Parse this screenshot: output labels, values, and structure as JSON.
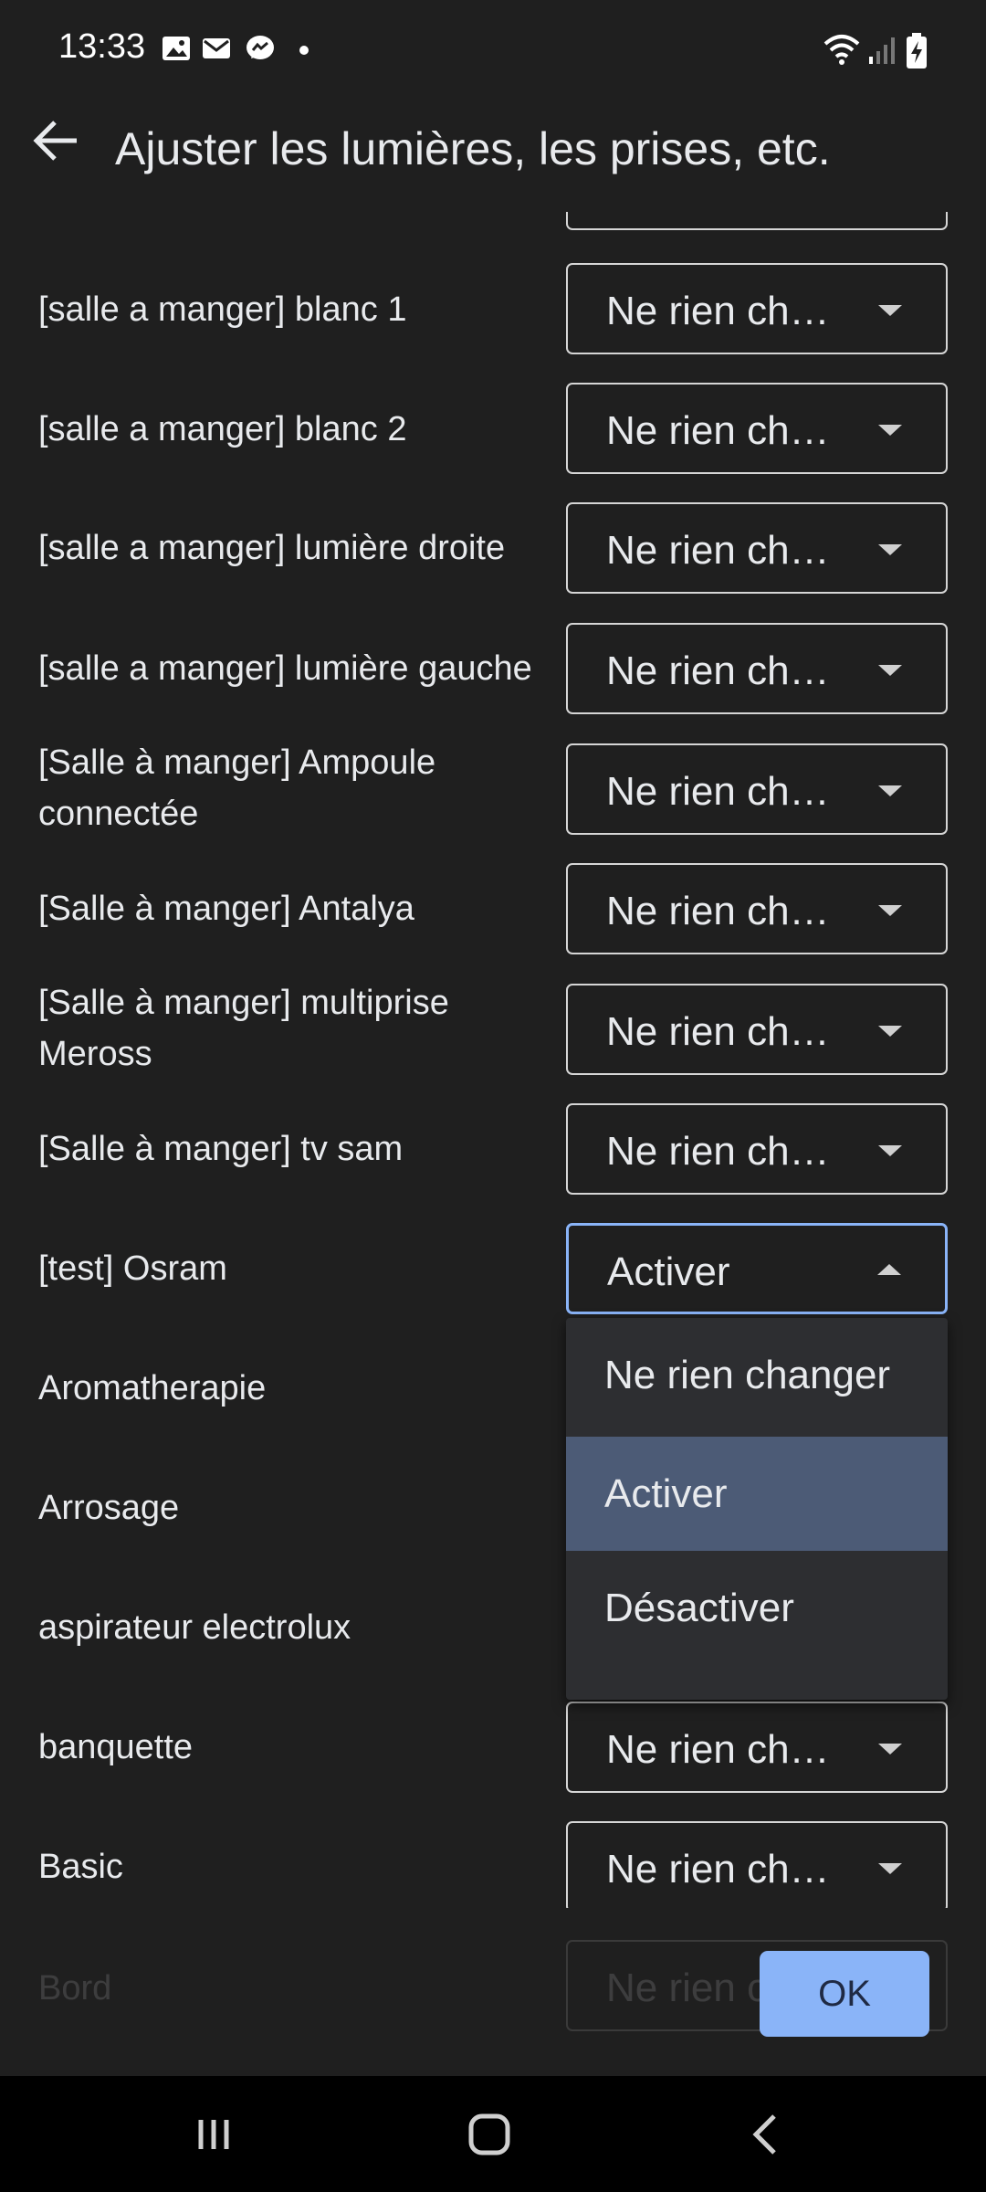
{
  "status_bar": {
    "time": "13:33"
  },
  "header": {
    "title": "Ajuster les lumières, les prises, etc."
  },
  "rows": [
    {
      "label": "[salle a manger] blanc 1",
      "value": "Ne rien ch…"
    },
    {
      "label": "[salle a manger] blanc 2",
      "value": "Ne rien ch…"
    },
    {
      "label": "[salle a manger] lumière droite",
      "value": "Ne rien ch…"
    },
    {
      "label": "[salle a manger] lumière gauche",
      "value": "Ne rien ch…"
    },
    {
      "label": "[Salle à manger] Ampoule connectée",
      "value": "Ne rien ch…"
    },
    {
      "label": "[Salle à manger] Antalya",
      "value": "Ne rien ch…"
    },
    {
      "label": "[Salle à manger] multiprise Meross",
      "value": "Ne rien ch…"
    },
    {
      "label": "[Salle à manger] tv sam",
      "value": "Ne rien ch…"
    },
    {
      "label": "[test] Osram",
      "value": "Activer"
    },
    {
      "label": "Aromatherapie"
    },
    {
      "label": "Arrosage"
    },
    {
      "label": "aspirateur electrolux"
    },
    {
      "label": "banquette",
      "value": "Ne rien ch…"
    },
    {
      "label": "Basic",
      "value": "Ne rien ch…"
    }
  ],
  "dropdown": {
    "options": [
      "Ne rien changer",
      "Activer",
      "Désactiver"
    ],
    "selected": "Activer"
  },
  "footer": {
    "faded_label": "Bord",
    "faded_value": "Ne rien ch…",
    "ok_label": "OK"
  }
}
